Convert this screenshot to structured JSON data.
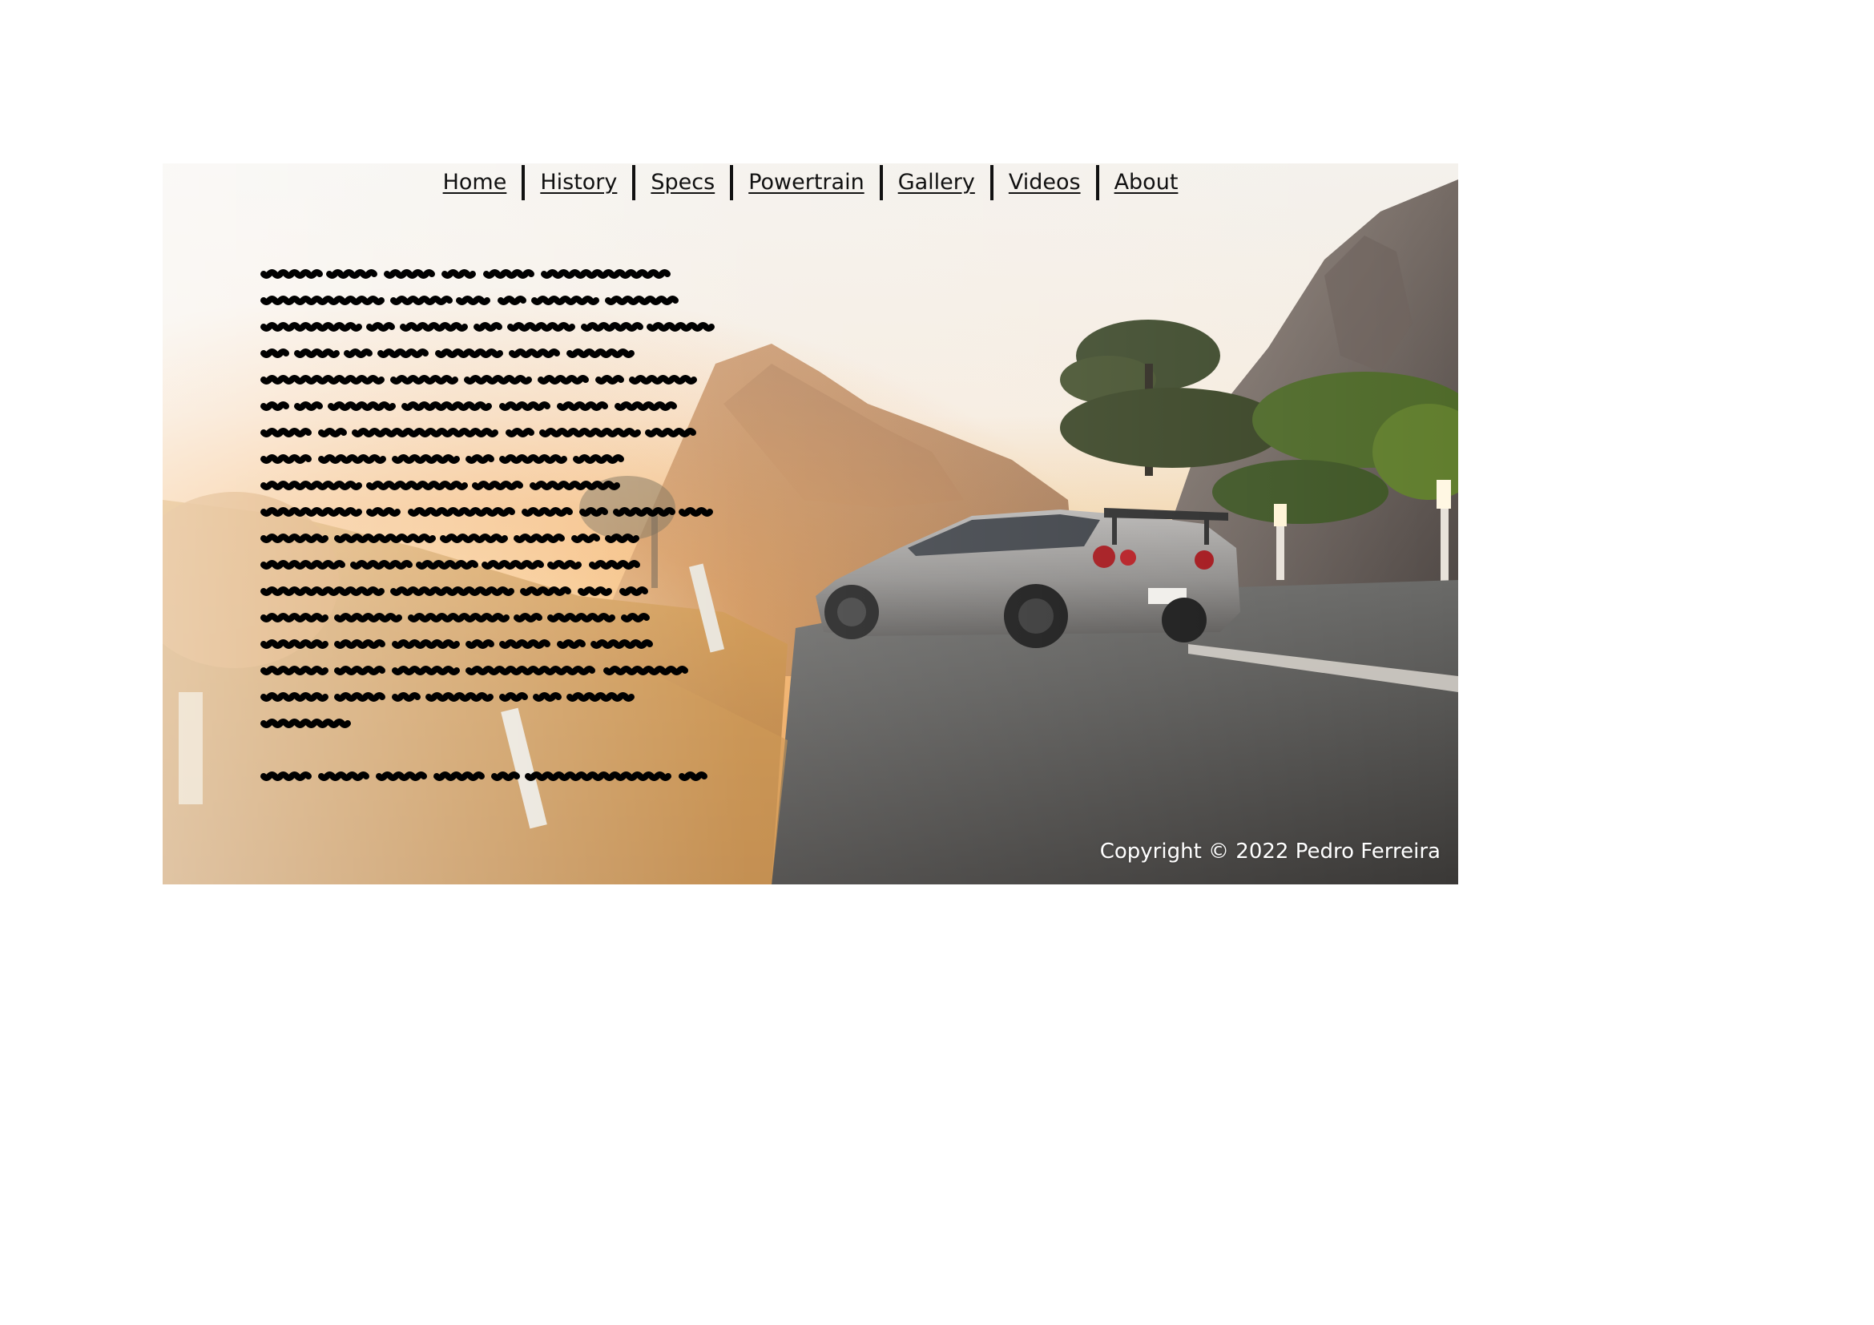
{
  "nav": {
    "items": [
      {
        "label": "Home"
      },
      {
        "label": "History"
      },
      {
        "label": "Specs"
      },
      {
        "label": "Powertrain"
      },
      {
        "label": "Gallery"
      },
      {
        "label": "Videos"
      },
      {
        "label": "About"
      }
    ]
  },
  "hero": {
    "image": "sunset-coastal-road-silver-sports-car-photo",
    "body_text_redacted": true
  },
  "footer": {
    "copyright": "Copyright © 2022 Pedro Ferreira"
  },
  "colors": {
    "nav_text": "#111111",
    "redaction_ink": "#000000",
    "copyright_text": "#ffffff",
    "page_background": "#ffffff"
  }
}
